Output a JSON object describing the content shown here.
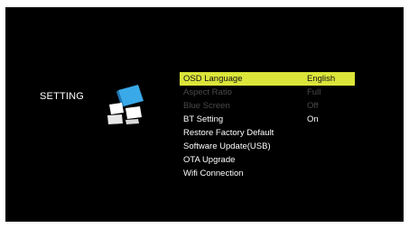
{
  "header": {
    "section_title": "SETTING",
    "icon": "setting-cube-icon"
  },
  "menu": {
    "items": [
      {
        "label": "OSD Language",
        "value": "English",
        "state": "selected"
      },
      {
        "label": "Aspect Ratio",
        "value": "Full",
        "state": "disabled"
      },
      {
        "label": "Blue Screen",
        "value": "Off",
        "state": "disabled"
      },
      {
        "label": "BT Setting",
        "value": "On",
        "state": "normal"
      },
      {
        "label": "Restore Factory Default",
        "value": "",
        "state": "normal"
      },
      {
        "label": "Software Update(USB)",
        "value": "",
        "state": "normal"
      },
      {
        "label": "OTA Upgrade",
        "value": "",
        "state": "normal"
      },
      {
        "label": "Wifi Connection",
        "value": "",
        "state": "normal"
      }
    ]
  },
  "colors": {
    "background": "#000000",
    "highlight": "#dbe53a",
    "text": "#ffffff",
    "disabled_text": "#4a4a4a",
    "icon_blue": "#3aa9e8"
  }
}
